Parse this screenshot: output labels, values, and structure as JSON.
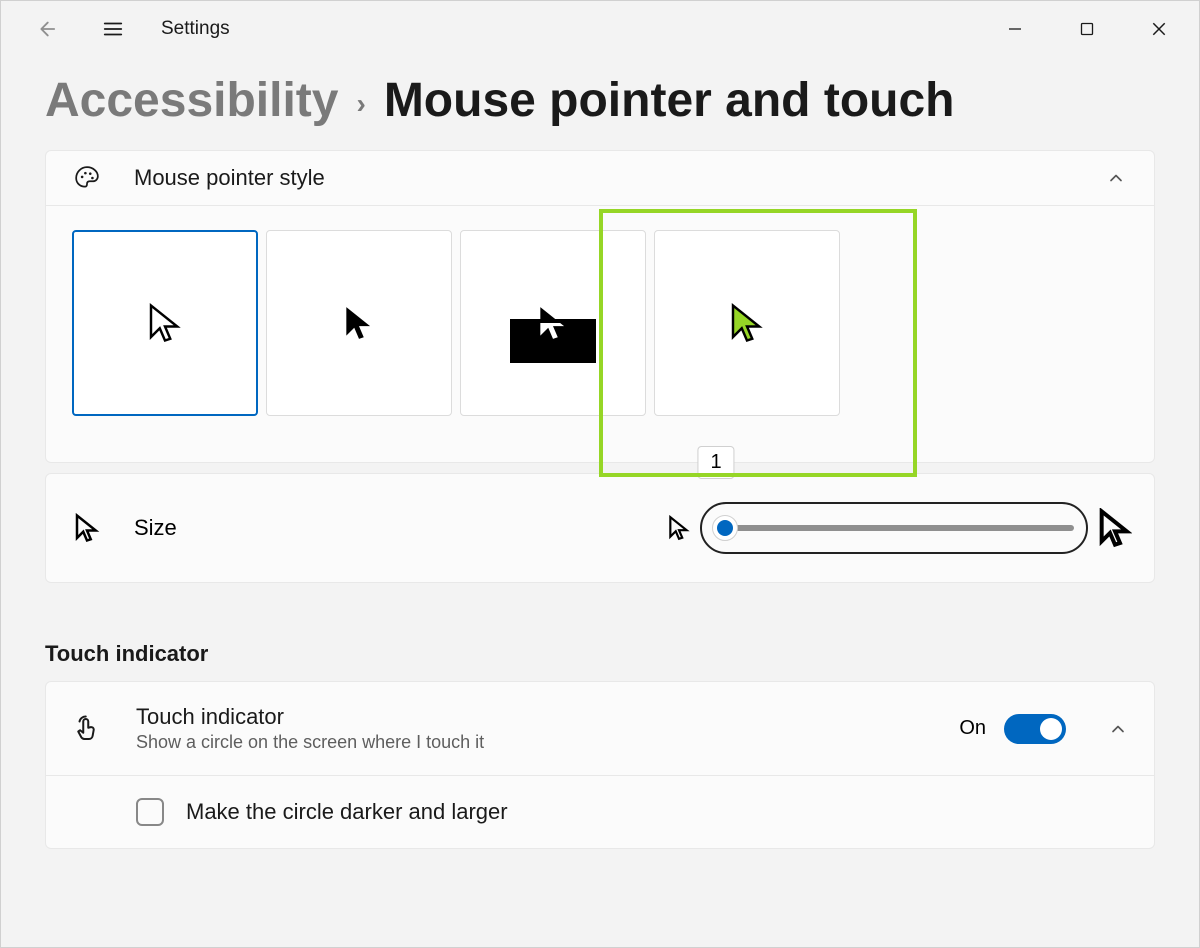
{
  "app_title": "Settings",
  "breadcrumb": {
    "parent": "Accessibility",
    "title": "Mouse pointer and touch"
  },
  "pointer_style": {
    "label": "Mouse pointer style",
    "options": [
      "white",
      "black",
      "inverted",
      "custom"
    ],
    "selected_index": 0
  },
  "size": {
    "label": "Size",
    "value": "1"
  },
  "touch_section_heading": "Touch indicator",
  "touch_indicator": {
    "title": "Touch indicator",
    "description": "Show a circle on the screen where I touch it",
    "state_label": "On",
    "on": true
  },
  "touch_option": {
    "label": "Make the circle darker and larger",
    "checked": false
  }
}
